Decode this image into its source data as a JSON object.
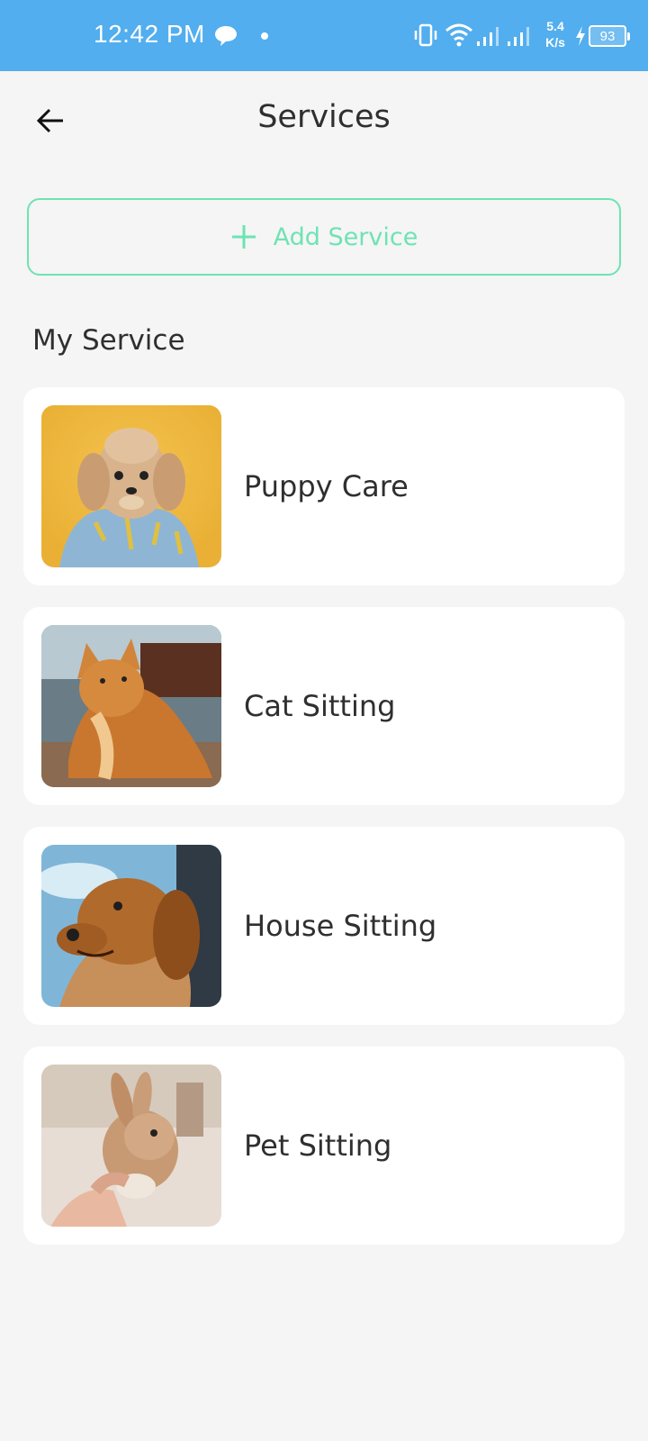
{
  "status_bar": {
    "time": "12:42 PM",
    "speed_value": "5.4",
    "speed_unit": "K/s",
    "battery": "93",
    "icons": [
      "message-icon",
      "dot-icon",
      "vibrate-icon",
      "wifi-icon",
      "signal-icon",
      "signal-icon",
      "charging-icon",
      "battery-icon"
    ],
    "background_color": "#52aeee"
  },
  "header": {
    "back_icon": "arrow-left-icon",
    "title": "Services"
  },
  "add_service": {
    "icon": "plus-icon",
    "label": "Add Service",
    "accent_color": "#6ee3b4"
  },
  "section": {
    "title": "My Service"
  },
  "services": [
    {
      "name": "Puppy Care",
      "image": "puppy-photo"
    },
    {
      "name": "Cat Sitting",
      "image": "cat-photo"
    },
    {
      "name": "House Sitting",
      "image": "dog-photo"
    },
    {
      "name": "Pet Sitting",
      "image": "rabbit-photo"
    }
  ]
}
